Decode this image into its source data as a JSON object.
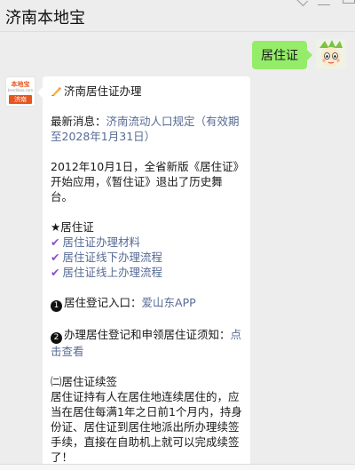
{
  "header": {
    "title": "济南本地宝"
  },
  "outgoing": {
    "text": "居住证"
  },
  "bot": {
    "logo_top": "本地宝",
    "logo_mid": "bendibao.com",
    "logo_city": "济南"
  },
  "message": {
    "title": "济南居住证办理",
    "news_label": "最新消息：",
    "news_link": "济南流动人口规定（有效期至2028年1月31日）",
    "history": "2012年10月1日，全省新版《居住证》开始应用，《暂住证》退出了历史舞台。",
    "section_star": "★居住证",
    "links": [
      "居住证办理材料",
      "居住证线下办理流程",
      "居住证线上办理流程"
    ],
    "item1_num": "1",
    "item1_label": "居住登记入口：",
    "item1_link": "爱山东APP",
    "item2_num": "2",
    "item2_label": "办理居住登记和申领居住证须知：",
    "item2_link": "点击查看",
    "renew_title": "㈡居住证续签",
    "renew_body": "居住证持有人在居住地连续居住的，应当在居住每满1年之日前1个月内，持身份证、居住证到居住地派出所办理续签手续，直接在自助机上就可以完成续签了！"
  }
}
